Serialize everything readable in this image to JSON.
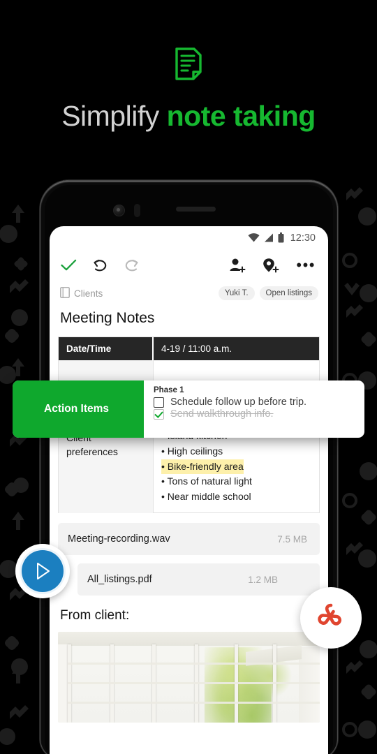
{
  "header": {
    "logo_icon": "note-document-icon",
    "headline_plain": "Simplify ",
    "headline_accent": "note taking",
    "accent_color": "#16b830"
  },
  "phone": {
    "camera_icon": "front-camera-icon",
    "sensor_icon": "proximity-sensor-icon",
    "speaker_icon": "earpiece-speaker-icon"
  },
  "statusbar": {
    "wifi_icon": "wifi-icon",
    "signal_icon": "cell-signal-icon",
    "battery_icon": "battery-icon",
    "time": "12:30"
  },
  "toolbar": {
    "done_icon": "checkmark-icon",
    "undo_icon": "undo-icon",
    "redo_icon": "redo-icon",
    "add_person_icon": "add-person-icon",
    "add_tag_icon": "add-tag-icon",
    "more_icon": "more-options-icon",
    "more_label": "•••"
  },
  "meta": {
    "notebook_icon": "notebook-icon",
    "notebook": "Clients",
    "tags": [
      "Yuki T.",
      "Open listings"
    ]
  },
  "note": {
    "title": "Meeting Notes",
    "table": {
      "header_row": {
        "label": "Date/Time",
        "value": "4-19 / 11:00 a.m."
      },
      "prefs_row": {
        "label": "Client preferences",
        "items": [
          {
            "text": "• Island kitchen",
            "highlight": false
          },
          {
            "text": "• High ceilings",
            "highlight": false
          },
          {
            "text": "• Bike-friendly area",
            "highlight": true
          },
          {
            "text": "• Tons of natural light",
            "highlight": false
          },
          {
            "text": "• Near middle school",
            "highlight": false
          }
        ],
        "highlight_color": "#fdf0ab"
      }
    },
    "attachments": [
      {
        "name": "Meeting-recording.wav",
        "size": "7.5 MB"
      },
      {
        "name": "All_listings.pdf",
        "size": "1.2 MB"
      }
    ],
    "from_client_label": "From client:",
    "photo_alt_icon": "room-photo"
  },
  "action_card": {
    "title": "Action Items",
    "title_bg": "#0fa82d",
    "phase_label": "Phase 1",
    "items": [
      {
        "text": "Schedule follow up before trip.",
        "checked": false
      },
      {
        "text": "Send walkthrough info.",
        "checked": true
      }
    ]
  },
  "badges": {
    "play_icon": "play-icon",
    "play_color": "#1b7fc0",
    "pdf_icon": "adobe-acrobat-pdf-icon",
    "pdf_color": "#e0452f"
  }
}
